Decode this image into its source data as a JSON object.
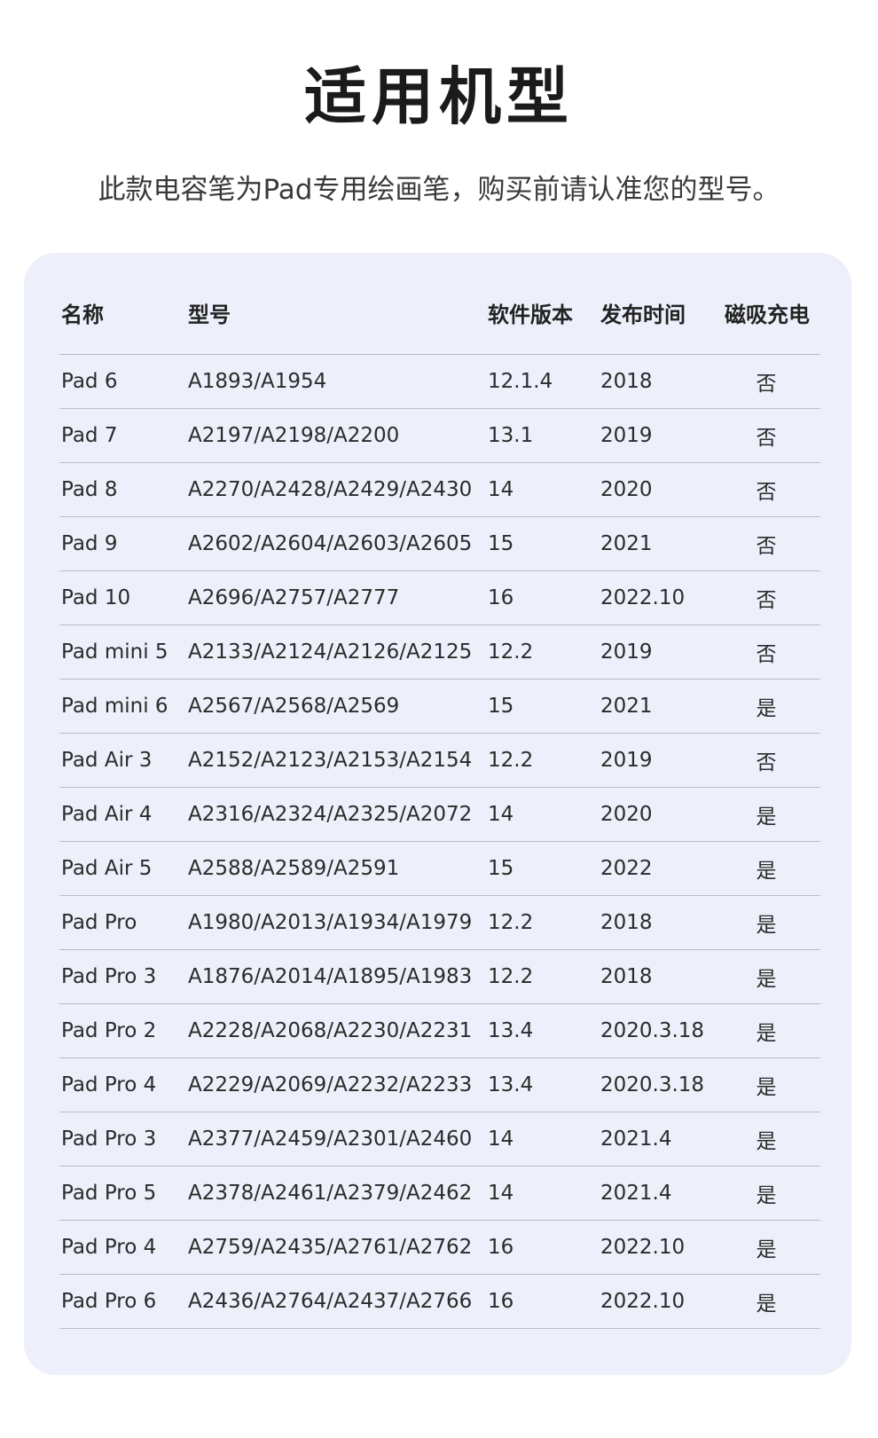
{
  "title": "适用机型",
  "subtitle": "此款电容笔为Pad专用绘画笔，购买前请认准您的型号。",
  "table": {
    "headers": {
      "name": "名称",
      "model": "型号",
      "software": "软件版本",
      "release": "发布时间",
      "magnetic": "磁吸充电"
    },
    "rows": [
      {
        "name": "Pad 6",
        "model": "A1893/A1954",
        "software": "12.1.4",
        "release": "2018",
        "magnetic": "否"
      },
      {
        "name": "Pad 7",
        "model": "A2197/A2198/A2200",
        "software": "13.1",
        "release": "2019",
        "magnetic": "否"
      },
      {
        "name": "Pad 8",
        "model": "A2270/A2428/A2429/A2430",
        "software": "14",
        "release": "2020",
        "magnetic": "否"
      },
      {
        "name": "Pad 9",
        "model": "A2602/A2604/A2603/A2605",
        "software": "15",
        "release": "2021",
        "magnetic": "否"
      },
      {
        "name": "Pad 10",
        "model": "A2696/A2757/A2777",
        "software": "16",
        "release": "2022.10",
        "magnetic": "否"
      },
      {
        "name": "Pad mini 5",
        "model": "A2133/A2124/A2126/A2125",
        "software": "12.2",
        "release": "2019",
        "magnetic": "否"
      },
      {
        "name": "Pad mini 6",
        "model": "A2567/A2568/A2569",
        "software": "15",
        "release": "2021",
        "magnetic": "是"
      },
      {
        "name": "Pad Air 3",
        "model": "A2152/A2123/A2153/A2154",
        "software": "12.2",
        "release": "2019",
        "magnetic": "否"
      },
      {
        "name": "Pad Air 4",
        "model": "A2316/A2324/A2325/A2072",
        "software": "14",
        "release": "2020",
        "magnetic": "是"
      },
      {
        "name": "Pad Air 5",
        "model": "A2588/A2589/A2591",
        "software": "15",
        "release": "2022",
        "magnetic": "是"
      },
      {
        "name": "Pad Pro",
        "model": "A1980/A2013/A1934/A1979",
        "software": "12.2",
        "release": "2018",
        "magnetic": "是"
      },
      {
        "name": "Pad Pro 3",
        "model": "A1876/A2014/A1895/A1983",
        "software": "12.2",
        "release": "2018",
        "magnetic": "是"
      },
      {
        "name": "Pad Pro 2",
        "model": "A2228/A2068/A2230/A2231",
        "software": "13.4",
        "release": "2020.3.18",
        "magnetic": "是"
      },
      {
        "name": "Pad Pro 4",
        "model": "A2229/A2069/A2232/A2233",
        "software": "13.4",
        "release": "2020.3.18",
        "magnetic": "是"
      },
      {
        "name": "Pad Pro 3",
        "model": "A2377/A2459/A2301/A2460",
        "software": "14",
        "release": "2021.4",
        "magnetic": "是"
      },
      {
        "name": "Pad Pro 5",
        "model": "A2378/A2461/A2379/A2462",
        "software": "14",
        "release": "2021.4",
        "magnetic": "是"
      },
      {
        "name": "Pad Pro 4",
        "model": "A2759/A2435/A2761/A2762",
        "software": "16",
        "release": "2022.10",
        "magnetic": "是"
      },
      {
        "name": "Pad Pro 6",
        "model": "A2436/A2764/A2437/A2766",
        "software": "16",
        "release": "2022.10",
        "magnetic": "是"
      }
    ]
  }
}
